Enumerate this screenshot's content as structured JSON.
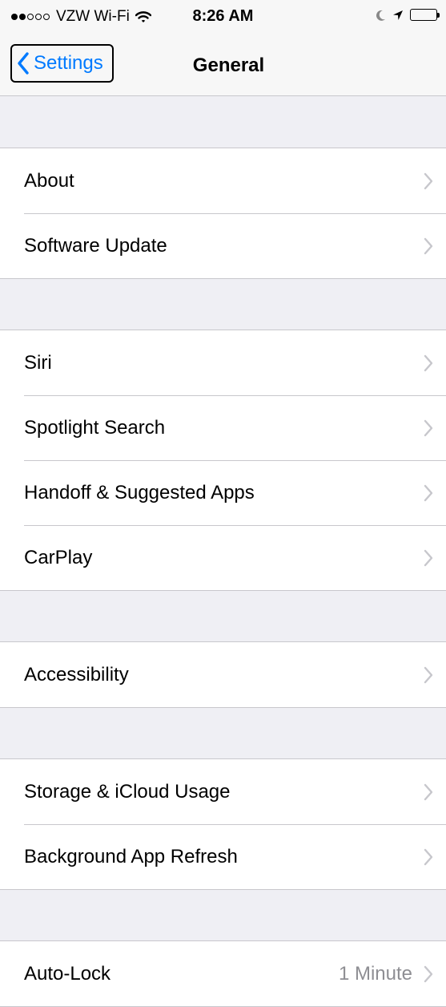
{
  "status_bar": {
    "carrier": "VZW Wi-Fi",
    "signal_bars_filled": 2,
    "signal_bars_total": 5,
    "time": "8:26 AM",
    "icons": [
      "wifi-icon",
      "moon-icon",
      "location-icon",
      "battery-icon"
    ]
  },
  "nav": {
    "back_label": "Settings",
    "title": "General"
  },
  "colors": {
    "accent": "#007aff",
    "background": "#efeff4",
    "separator": "#c8c7cc",
    "chevron": "#c7c7cc",
    "secondary_text": "#8e8e93"
  },
  "groups": [
    {
      "items": [
        {
          "label": "About"
        },
        {
          "label": "Software Update"
        }
      ]
    },
    {
      "items": [
        {
          "label": "Siri"
        },
        {
          "label": "Spotlight Search"
        },
        {
          "label": "Handoff & Suggested Apps"
        },
        {
          "label": "CarPlay"
        }
      ]
    },
    {
      "items": [
        {
          "label": "Accessibility"
        }
      ]
    },
    {
      "items": [
        {
          "label": "Storage & iCloud Usage"
        },
        {
          "label": "Background App Refresh"
        }
      ]
    },
    {
      "items": [
        {
          "label": "Auto-Lock",
          "value": "1 Minute"
        }
      ]
    }
  ]
}
